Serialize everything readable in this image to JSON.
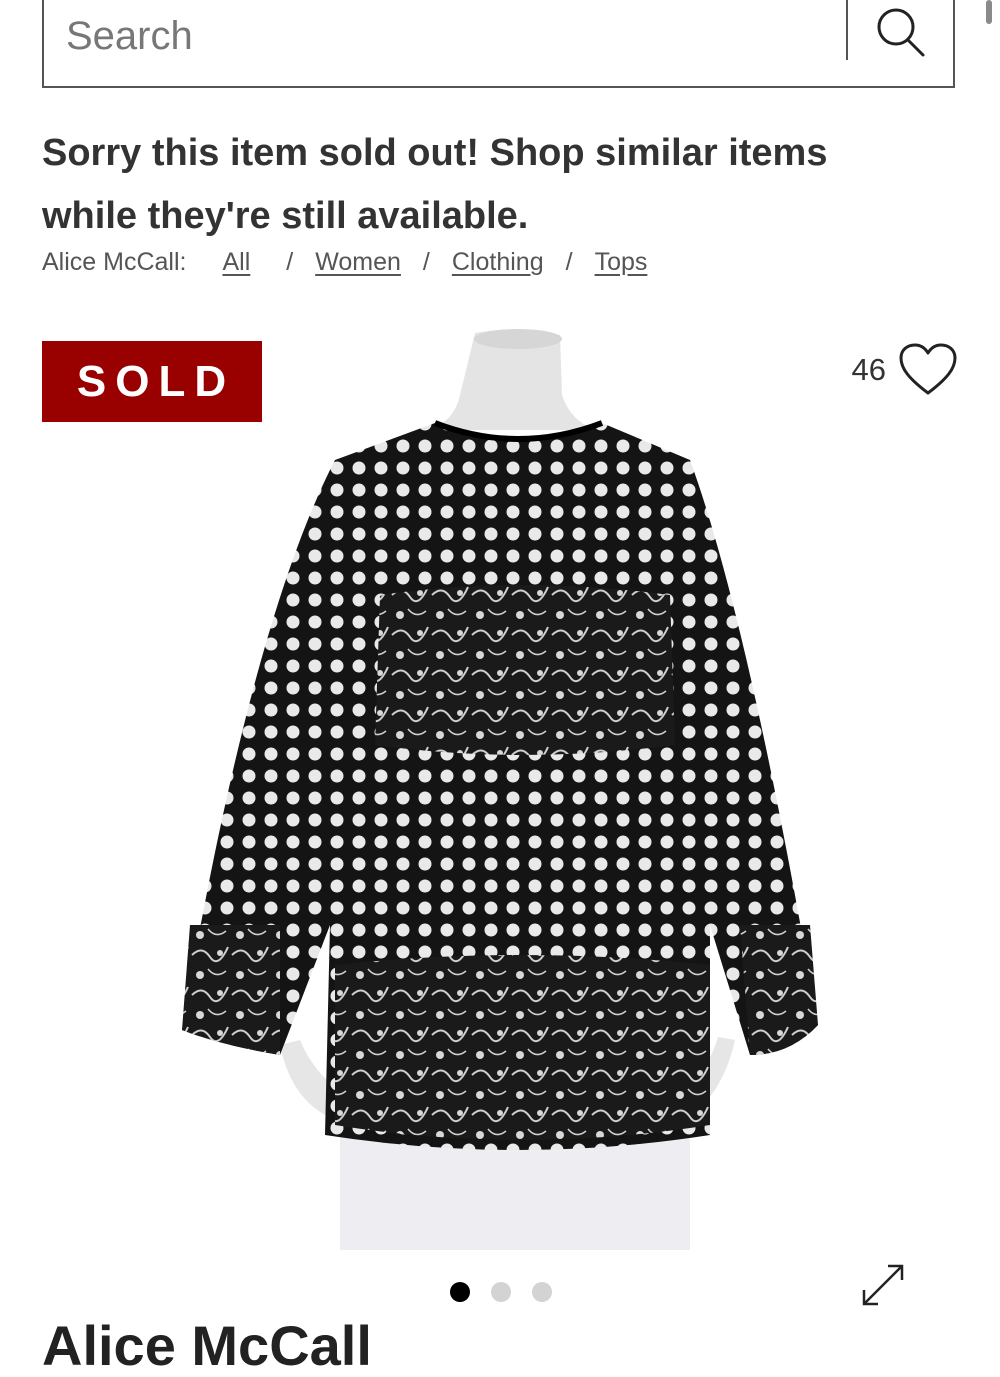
{
  "search": {
    "placeholder": "Search",
    "value": "",
    "button_icon": "search-icon"
  },
  "notice": {
    "headline": "Sorry this item sold out! Shop similar items while they're still available."
  },
  "breadcrumb": {
    "brand": "Alice McCall:",
    "items": [
      "All",
      "Women",
      "Clothing",
      "Tops"
    ],
    "separator": "/"
  },
  "product": {
    "badge": "SOLD",
    "favorites_count": "46",
    "favorite_icon": "heart-outline-icon",
    "image_description_icon": "product-photo",
    "gallery": {
      "total": 3,
      "active_index": 0
    },
    "expand_icon": "expand-arrows-icon",
    "title_peek": "Alice McCall"
  },
  "colors": {
    "sold_badge": "#990000",
    "text": "#333333",
    "dot_active": "#000000",
    "dot_inactive": "#d3d3d3"
  }
}
